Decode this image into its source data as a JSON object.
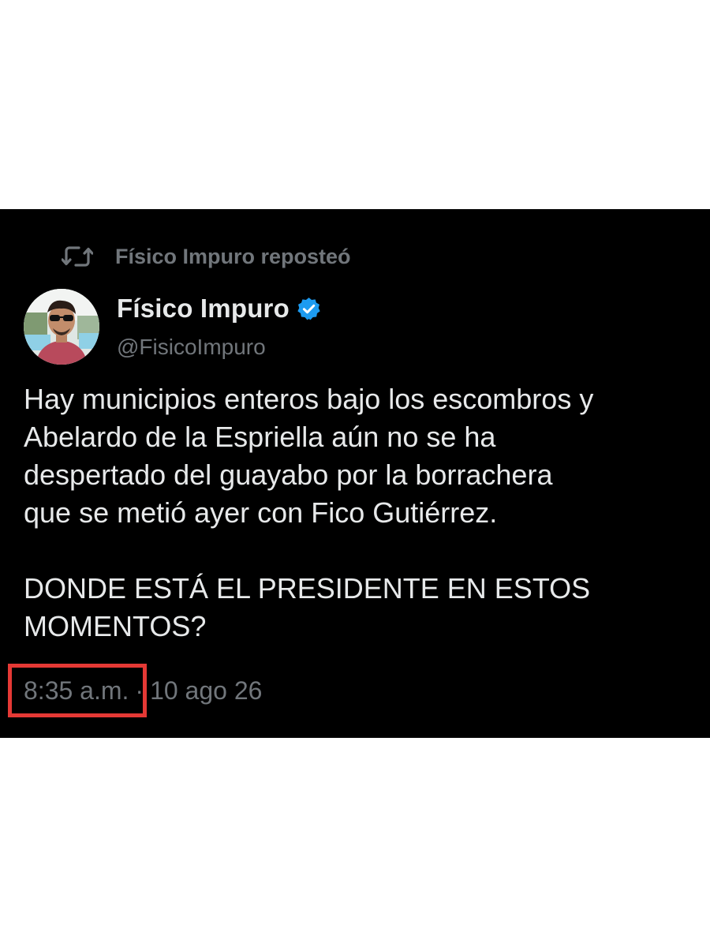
{
  "repost": {
    "icon": "repost-icon",
    "label": "Físico Impuro reposteó"
  },
  "author": {
    "avatar_icon": "avatar",
    "display_name": "Físico Impuro",
    "verified_icon": "verified-badge-icon",
    "handle": "@FisicoImpuro"
  },
  "tweet": {
    "text": "Hay municipios enteros bajo los escombros y\nAbelardo de la Espriella aún no se ha\ndespertado del guayabo por la borrachera\nque se metió ayer con Fico Gutiérrez.\n\nDONDE ESTÁ EL PRESIDENTE EN ESTOS\nMOMENTOS?",
    "time": "8:35 a.m.",
    "separator": "·",
    "date": "10 ago 26"
  },
  "colors": {
    "background": "#000000",
    "primary_text": "#e7e9ea",
    "secondary_text": "#71767b",
    "verified_blue": "#1d9bf0",
    "highlight_red": "#e53935"
  }
}
